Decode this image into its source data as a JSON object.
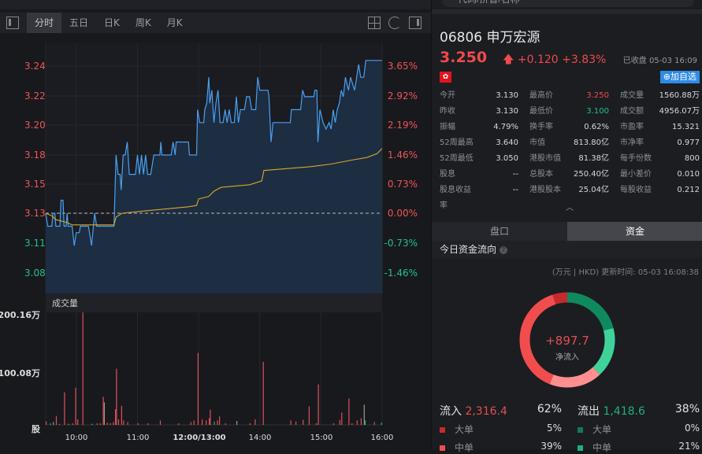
{
  "search": {
    "placeholder": "代码/拼音/名称"
  },
  "toolbar": {
    "tabs": [
      "分时",
      "五日",
      "日K",
      "周K",
      "月K"
    ],
    "active": 0
  },
  "chart_data": {
    "type": "line",
    "title": "分时",
    "prev_close": 3.13,
    "y_ticks": [
      "3.24",
      "3.22",
      "3.20",
      "3.18",
      "3.15",
      "3.13",
      "3.11",
      "3.08"
    ],
    "pct_ticks": [
      "3.65%",
      "2.92%",
      "2.19%",
      "1.46%",
      "0.73%",
      "0.00%",
      "-0.73%",
      "-1.46%"
    ],
    "x_ticks": [
      "10:00",
      "11:00",
      "12:00/13:00",
      "14:00",
      "15:00",
      "16:00"
    ],
    "series": [
      {
        "name": "price",
        "color": "#4aa0f0",
        "points": [
          [
            0,
            3.13
          ],
          [
            2,
            3.12
          ],
          [
            6,
            3.12
          ],
          [
            7,
            3.13
          ],
          [
            9,
            3.13
          ],
          [
            10,
            3.12
          ],
          [
            14,
            3.12
          ],
          [
            15,
            3.14
          ],
          [
            17,
            3.14
          ],
          [
            18,
            3.12
          ],
          [
            20,
            3.12
          ],
          [
            21,
            3.13
          ],
          [
            22,
            3.12
          ],
          [
            26,
            3.12
          ],
          [
            28,
            3.105
          ],
          [
            30,
            3.115
          ],
          [
            33,
            3.115
          ],
          [
            34,
            3.12
          ],
          [
            42,
            3.12
          ],
          [
            45,
            3.105
          ],
          [
            48,
            3.13
          ],
          [
            50,
            3.12
          ],
          [
            67,
            3.12
          ],
          [
            69,
            3.175
          ],
          [
            71,
            3.16
          ],
          [
            73,
            3.16
          ],
          [
            74,
            3.148
          ],
          [
            76,
            3.175
          ],
          [
            78,
            3.175
          ],
          [
            80,
            3.185
          ],
          [
            82,
            3.16
          ],
          [
            88,
            3.16
          ],
          [
            90,
            3.175
          ],
          [
            92,
            3.16
          ],
          [
            94,
            3.175
          ],
          [
            96,
            3.16
          ],
          [
            98,
            3.175
          ],
          [
            100,
            3.16
          ],
          [
            103,
            3.16
          ],
          [
            106,
            3.175
          ],
          [
            112,
            3.175
          ],
          [
            113,
            3.185
          ],
          [
            114,
            3.175
          ],
          [
            123,
            3.175
          ],
          [
            125,
            3.185
          ],
          [
            127,
            3.175
          ],
          [
            128,
            3.185
          ],
          [
            140,
            3.185
          ],
          [
            141,
            3.175
          ],
          [
            148,
            3.175
          ],
          [
            149,
            3.21
          ],
          [
            151,
            3.2
          ],
          [
            155,
            3.2
          ],
          [
            156,
            3.21
          ],
          [
            158,
            3.215
          ],
          [
            160,
            3.235
          ],
          [
            161,
            3.215
          ],
          [
            163,
            3.225
          ],
          [
            165,
            3.2
          ],
          [
            167,
            3.215
          ],
          [
            169,
            3.225
          ],
          [
            171,
            3.2
          ],
          [
            174,
            3.2
          ],
          [
            176,
            3.21
          ],
          [
            178,
            3.2
          ],
          [
            180,
            3.21
          ],
          [
            182,
            3.2
          ],
          [
            185,
            3.2
          ],
          [
            187,
            3.22
          ],
          [
            189,
            3.2
          ],
          [
            191,
            3.21
          ],
          [
            195,
            3.21
          ],
          [
            197,
            3.22
          ],
          [
            200,
            3.22
          ],
          [
            202,
            3.21
          ],
          [
            206,
            3.21
          ],
          [
            208,
            3.235
          ],
          [
            210,
            3.225
          ],
          [
            218,
            3.225
          ],
          [
            219,
            3.22
          ],
          [
            221,
            3.185
          ],
          [
            223,
            3.2
          ],
          [
            240,
            3.2
          ],
          [
            241,
            3.21
          ],
          [
            250,
            3.21
          ],
          [
            252,
            3.225
          ],
          [
            254,
            3.22
          ],
          [
            263,
            3.22
          ],
          [
            264,
            3.225
          ],
          [
            266,
            3.225
          ],
          [
            267,
            3.185
          ],
          [
            269,
            3.21
          ],
          [
            272,
            3.2
          ],
          [
            275,
            3.195
          ],
          [
            278,
            3.2
          ],
          [
            280,
            3.195
          ],
          [
            282,
            3.21
          ],
          [
            284,
            3.2
          ],
          [
            286,
            3.21
          ],
          [
            288,
            3.215
          ],
          [
            290,
            3.225
          ],
          [
            292,
            3.22
          ],
          [
            294,
            3.235
          ],
          [
            297,
            3.225
          ],
          [
            299,
            3.235
          ],
          [
            303,
            3.225
          ],
          [
            305,
            3.235
          ],
          [
            307,
            3.245
          ],
          [
            309,
            3.235
          ],
          [
            312,
            3.235
          ],
          [
            314,
            3.248
          ],
          [
            330,
            3.248
          ]
        ]
      },
      {
        "name": "avg",
        "color": "#d9a72a",
        "points": [
          [
            0,
            3.13
          ],
          [
            6,
            3.128
          ],
          [
            10,
            3.125
          ],
          [
            20,
            3.123
          ],
          [
            26,
            3.121
          ],
          [
            67,
            3.121
          ],
          [
            69,
            3.127
          ],
          [
            75,
            3.13
          ],
          [
            100,
            3.132
          ],
          [
            140,
            3.135
          ],
          [
            148,
            3.136
          ],
          [
            150,
            3.141
          ],
          [
            160,
            3.143
          ],
          [
            165,
            3.147
          ],
          [
            172,
            3.15
          ],
          [
            200,
            3.152
          ],
          [
            212,
            3.155
          ],
          [
            214,
            3.163
          ],
          [
            260,
            3.166
          ],
          [
            280,
            3.168
          ],
          [
            300,
            3.171
          ],
          [
            315,
            3.173
          ],
          [
            325,
            3.176
          ],
          [
            330,
            3.18
          ]
        ]
      }
    ],
    "volume": {
      "title": "成交量",
      "ticks": [
        "200.16万",
        "100.08万",
        "股"
      ],
      "max": 200.16,
      "bars": [
        [
          0,
          6,
          "u"
        ],
        [
          4,
          3,
          "d"
        ],
        [
          7,
          5,
          "n"
        ],
        [
          10,
          16,
          "u"
        ],
        [
          13,
          2,
          "u"
        ],
        [
          18,
          58,
          "u"
        ],
        [
          22,
          2,
          "n"
        ],
        [
          26,
          3,
          "u"
        ],
        [
          29,
          66,
          "u"
        ],
        [
          31,
          10,
          "u"
        ],
        [
          36,
          200,
          "u"
        ],
        [
          45,
          2,
          "n"
        ],
        [
          50,
          3,
          "u"
        ],
        [
          53,
          3,
          "u"
        ],
        [
          56,
          50,
          "u"
        ],
        [
          57,
          40,
          "n"
        ],
        [
          60,
          4,
          "u"
        ],
        [
          63,
          3,
          "u"
        ],
        [
          66,
          5,
          "u"
        ],
        [
          68,
          28,
          "u"
        ],
        [
          69,
          100,
          "u"
        ],
        [
          71,
          10,
          "u"
        ],
        [
          74,
          34,
          "u"
        ],
        [
          76,
          8,
          "u"
        ],
        [
          80,
          5,
          "u"
        ],
        [
          90,
          3,
          "u"
        ],
        [
          100,
          3,
          "u"
        ],
        [
          112,
          8,
          "u"
        ],
        [
          130,
          3,
          "u"
        ],
        [
          142,
          5,
          "u"
        ],
        [
          145,
          8,
          "u"
        ],
        [
          149,
          128,
          "u"
        ],
        [
          153,
          10,
          "u"
        ],
        [
          157,
          8,
          "u"
        ],
        [
          160,
          12,
          "u"
        ],
        [
          161,
          27,
          "u"
        ],
        [
          165,
          6,
          "d"
        ],
        [
          168,
          8,
          "u"
        ],
        [
          170,
          15,
          "u"
        ],
        [
          176,
          3,
          "u"
        ],
        [
          187,
          7,
          "n"
        ],
        [
          200,
          3,
          "u"
        ],
        [
          205,
          10,
          "u"
        ],
        [
          213,
          112,
          "u"
        ],
        [
          240,
          8,
          "u"
        ],
        [
          245,
          6,
          "u"
        ],
        [
          252,
          9,
          "u"
        ],
        [
          258,
          33,
          "u"
        ],
        [
          265,
          3,
          "u"
        ],
        [
          267,
          72,
          "u"
        ],
        [
          282,
          3,
          "u"
        ],
        [
          288,
          9,
          "u"
        ],
        [
          290,
          22,
          "u"
        ],
        [
          297,
          47,
          "u"
        ],
        [
          300,
          3,
          "u"
        ],
        [
          305,
          8,
          "u"
        ],
        [
          309,
          12,
          "u"
        ],
        [
          312,
          36,
          "n"
        ],
        [
          313,
          8,
          "d"
        ],
        [
          322,
          5,
          "u"
        ],
        [
          329,
          4,
          "d"
        ]
      ]
    }
  },
  "quote": {
    "code": "06806",
    "name": "申万宏源",
    "price": "3.250",
    "change": "+0.120",
    "pct": "+3.83%",
    "status": "已收盘 05-03 16:09",
    "market_flag": "HK",
    "add_label": "加自选",
    "stats": [
      [
        [
          "今开",
          "3.130",
          ""
        ],
        [
          "最高价",
          "3.250",
          "up"
        ],
        [
          "成交量",
          "1560.88万",
          ""
        ]
      ],
      [
        [
          "昨收",
          "3.130",
          ""
        ],
        [
          "最低价",
          "3.100",
          "dn"
        ],
        [
          "成交额",
          "4956.07万",
          ""
        ]
      ],
      [
        [
          "振幅",
          "4.79%",
          ""
        ],
        [
          "换手率",
          "0.62%",
          ""
        ],
        [
          "市盈率",
          "15.321",
          ""
        ]
      ],
      [
        [
          "52周最高",
          "3.640",
          ""
        ],
        [
          "市值",
          "813.80亿",
          ""
        ],
        [
          "市净率",
          "0.977",
          ""
        ]
      ],
      [
        [
          "52周最低",
          "3.050",
          ""
        ],
        [
          "港股市值",
          "81.38亿",
          ""
        ],
        [
          "每手份数",
          "800",
          ""
        ]
      ],
      [
        [
          "股息",
          "--",
          ""
        ],
        [
          "总股本",
          "250.40亿",
          ""
        ],
        [
          "最小差价",
          "0.010",
          ""
        ]
      ],
      [
        [
          "股息收益率",
          "--",
          ""
        ],
        [
          "港股股本",
          "25.04亿",
          ""
        ],
        [
          "每股收益",
          "0.212",
          ""
        ]
      ]
    ]
  },
  "tabs": [
    "盘口",
    "资金"
  ],
  "flow": {
    "title": "今日资金流向",
    "unit_update": "(万元 | HKD) 更新时间: 05-03 16:08:38",
    "net": "+897.7",
    "net_label": "净流入",
    "in_label": "流入",
    "in_value": "2,316.4",
    "in_pct": "62%",
    "out_label": "流出",
    "out_value": "1,418.6",
    "out_pct": "38%",
    "in_rows": [
      [
        "大单",
        "5%"
      ],
      [
        "中单",
        "39%"
      ]
    ],
    "out_rows": [
      [
        "大单",
        "0%"
      ],
      [
        "中单",
        "21%"
      ]
    ],
    "donut": [
      {
        "name": "流出中单",
        "pct": 21,
        "color": "#0f8a5f"
      },
      {
        "name": "流出小单",
        "pct": 17,
        "color": "#3fd39a"
      },
      {
        "name": "流入小单",
        "pct": 18,
        "color": "#ff8f8f"
      },
      {
        "name": "流入中单",
        "pct": 39,
        "color": "#f24d4d"
      },
      {
        "name": "流入大单",
        "pct": 5,
        "color": "#c62a2a"
      }
    ],
    "colors": {
      "in_big": "#c62a2a",
      "in_mid": "#f24d4d",
      "out_big": "#0f7a55",
      "out_mid": "#1fb07c"
    }
  }
}
